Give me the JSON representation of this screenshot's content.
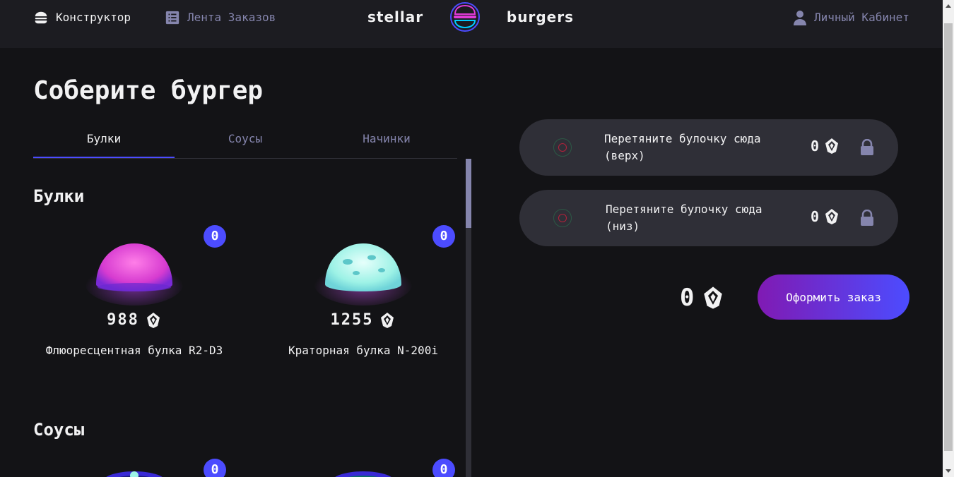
{
  "header": {
    "constructor_label": "Конструктор",
    "feed_label": "Лента Заказов",
    "account_label": "Личный Кабинет",
    "logo_left": "stellar",
    "logo_right": "burgers"
  },
  "main": {
    "title": "Соберите бургер",
    "tabs": [
      {
        "label": "Булки",
        "active": true
      },
      {
        "label": "Соусы",
        "active": false
      },
      {
        "label": "Начинки",
        "active": false
      }
    ],
    "sections": {
      "buns_title": "Булки",
      "sauces_title": "Соусы"
    },
    "buns": [
      {
        "name": "Флюоресцентная булка R2-D3",
        "price": "988",
        "count": "0",
        "color": "#e13bd8"
      },
      {
        "name": "Краторная булка N-200i",
        "price": "1255",
        "count": "0",
        "color": "#9df2e6"
      }
    ],
    "sauces": [
      {
        "count": "0"
      },
      {
        "count": "0"
      }
    ]
  },
  "constructor": {
    "top": {
      "text": "Перетяните булочку сюда (верх)",
      "price": "0"
    },
    "bottom": {
      "text": "Перетяните булочку сюда (низ)",
      "price": "0"
    },
    "total": "0",
    "order_button": "Оформить заказ"
  },
  "icons": {
    "currency": "crystal-currency-icon",
    "lock": "lock-icon",
    "burger": "burger-icon",
    "list": "list-icon",
    "profile": "profile-icon"
  },
  "colors": {
    "accent": "#4c4cff",
    "background": "#131316",
    "header": "#1c1c21",
    "inactive_text": "#8585ad"
  }
}
